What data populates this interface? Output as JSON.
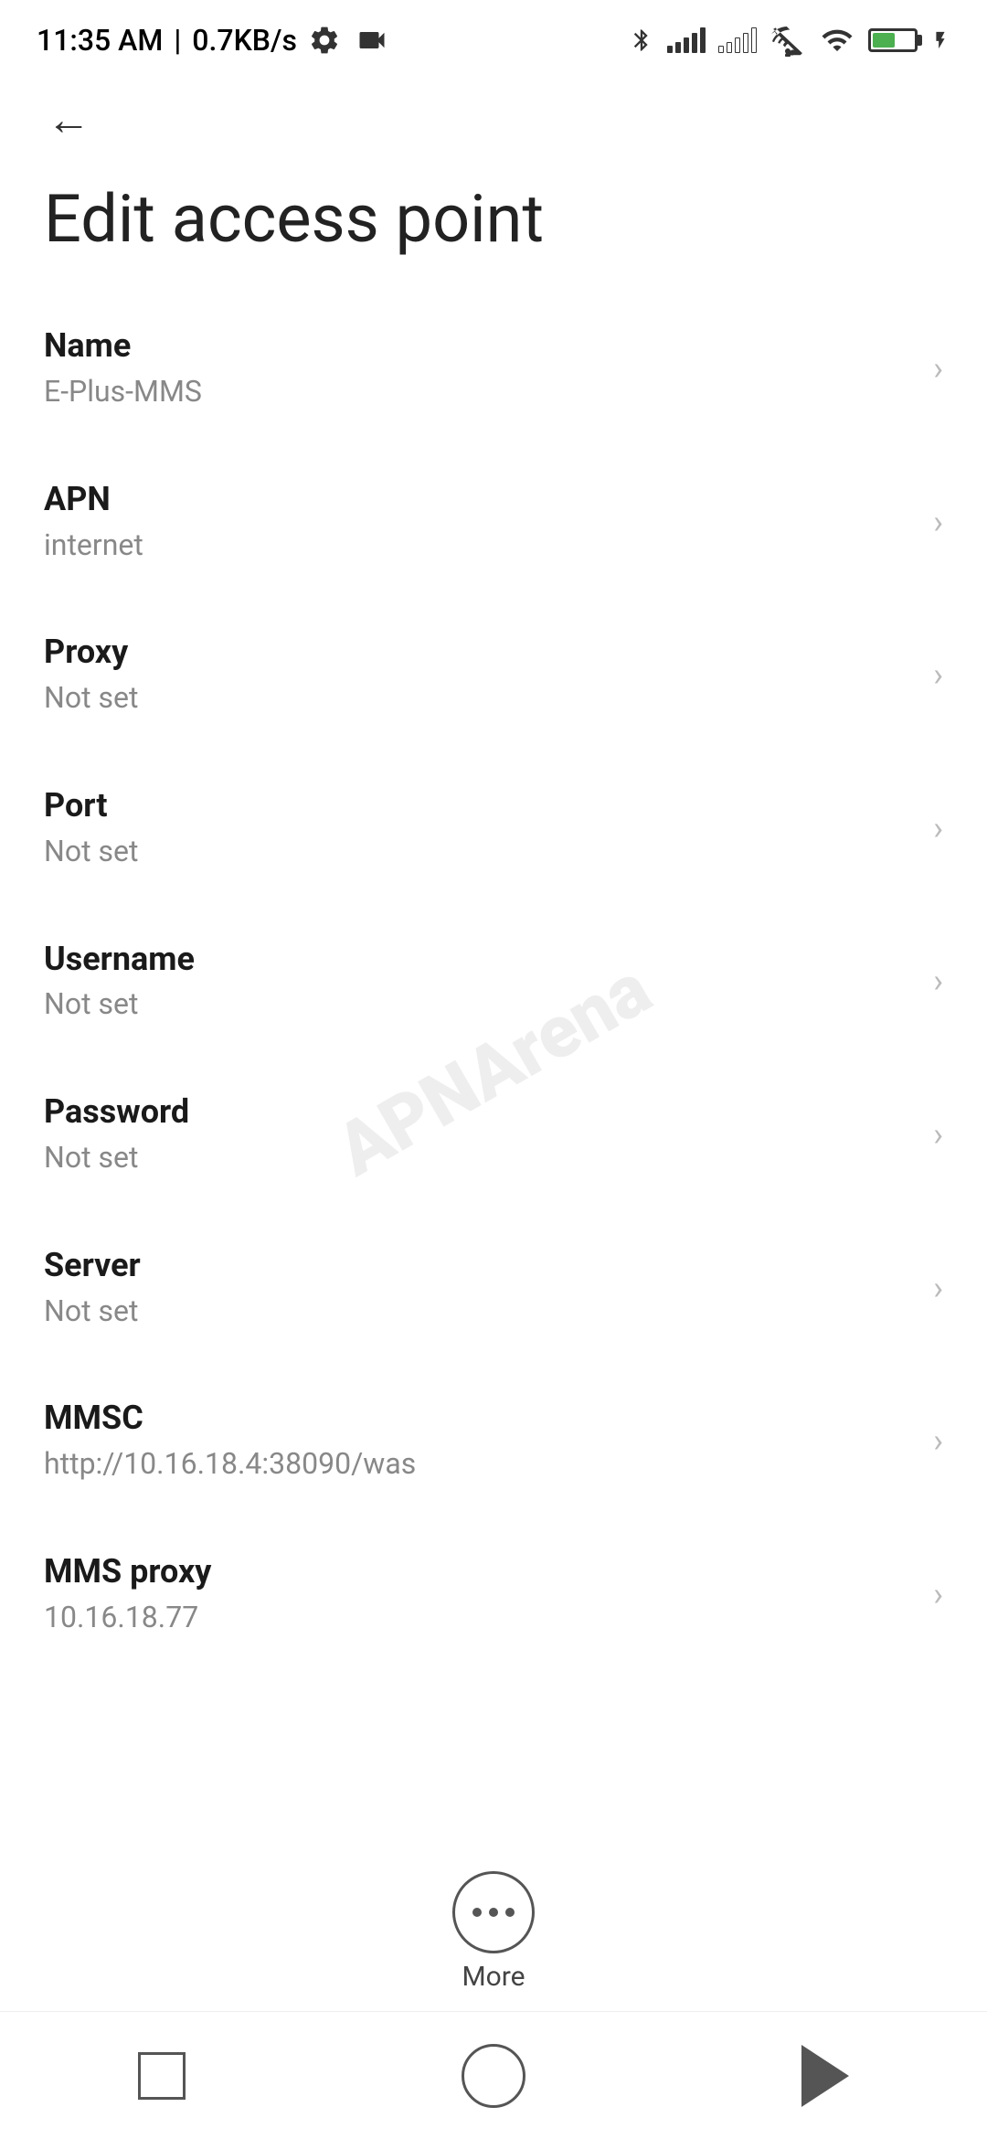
{
  "statusBar": {
    "time": "11:35 AM",
    "speed": "0.7KB/s"
  },
  "navigation": {
    "backLabel": "←"
  },
  "page": {
    "title": "Edit access point"
  },
  "settings": [
    {
      "id": "name",
      "label": "Name",
      "value": "E-Plus-MMS"
    },
    {
      "id": "apn",
      "label": "APN",
      "value": "internet"
    },
    {
      "id": "proxy",
      "label": "Proxy",
      "value": "Not set"
    },
    {
      "id": "port",
      "label": "Port",
      "value": "Not set"
    },
    {
      "id": "username",
      "label": "Username",
      "value": "Not set"
    },
    {
      "id": "password",
      "label": "Password",
      "value": "Not set"
    },
    {
      "id": "server",
      "label": "Server",
      "value": "Not set"
    },
    {
      "id": "mmsc",
      "label": "MMSC",
      "value": "http://10.16.18.4:38090/was"
    },
    {
      "id": "mms-proxy",
      "label": "MMS proxy",
      "value": "10.16.18.77"
    }
  ],
  "more": {
    "label": "More"
  },
  "watermark": "APNArena"
}
